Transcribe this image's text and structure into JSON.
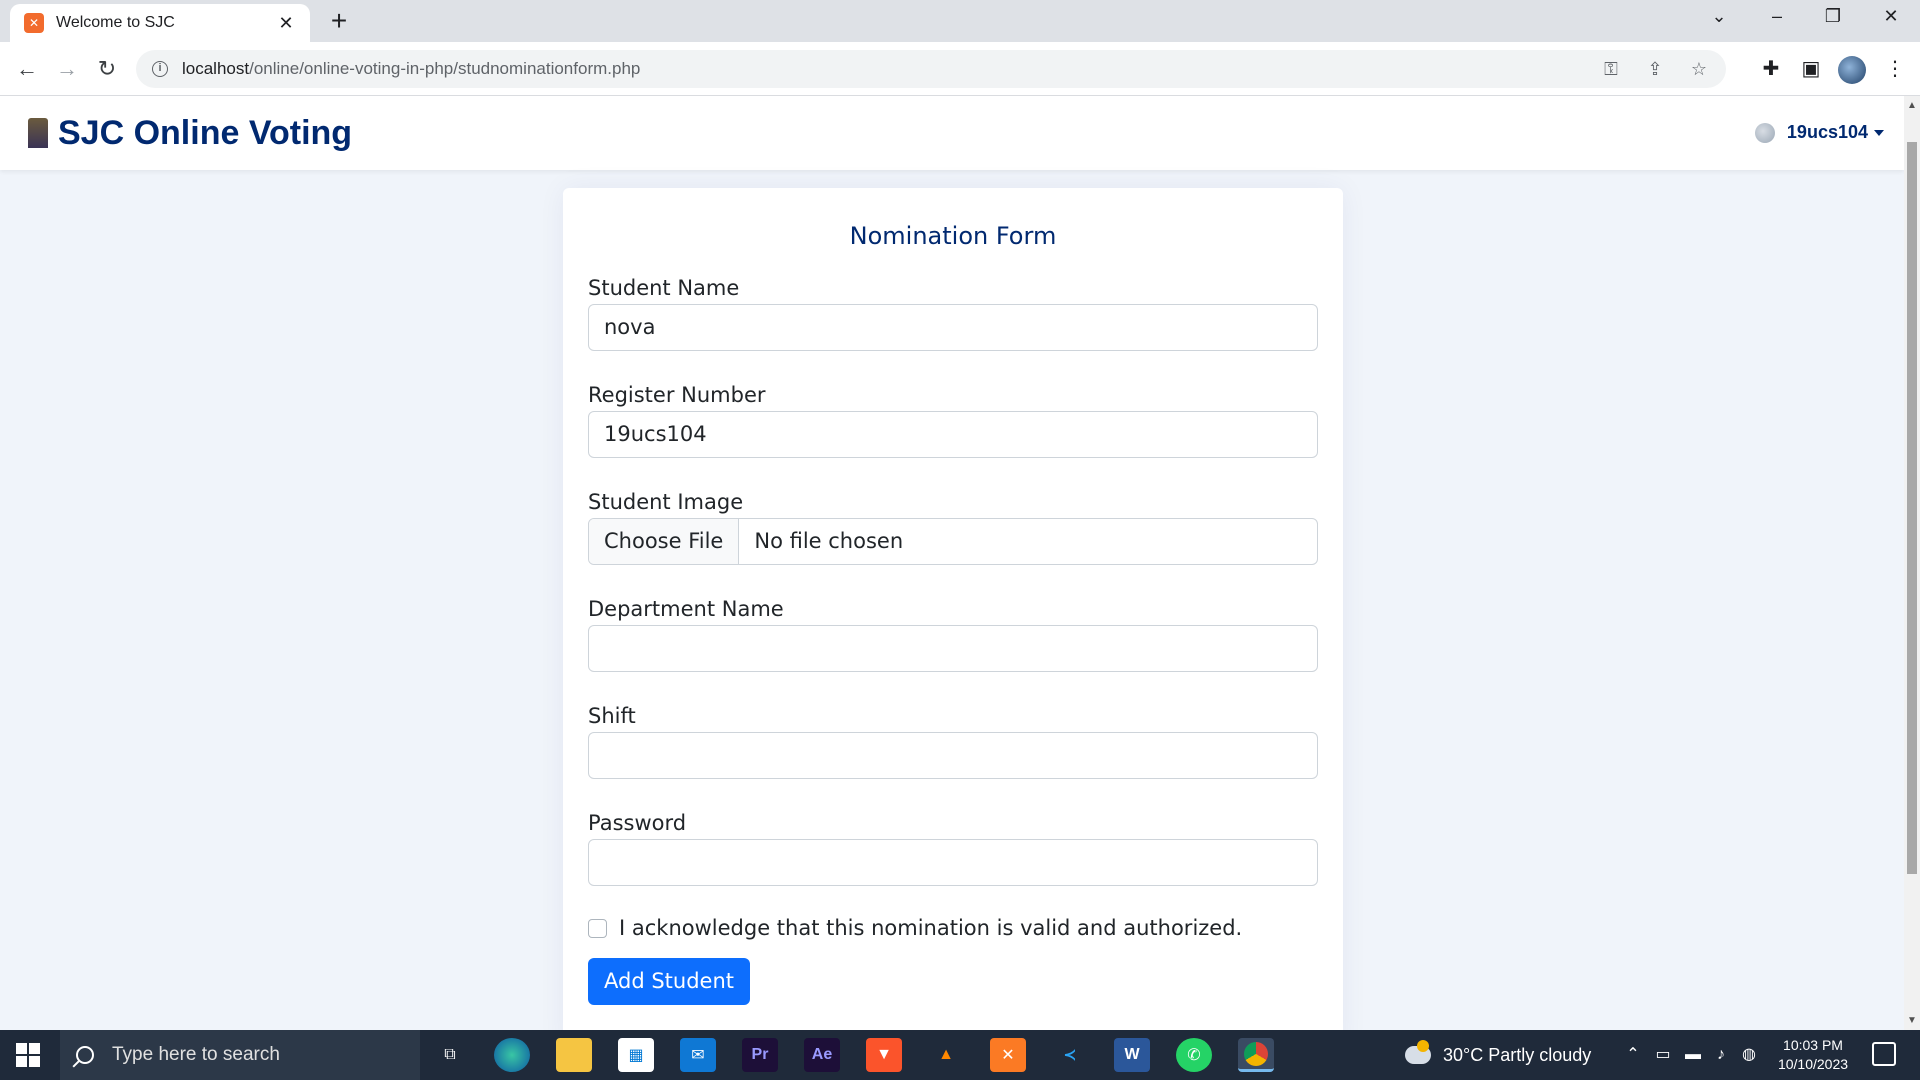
{
  "browser": {
    "tab_title": "Welcome to SJC",
    "tab_favicon": "xampp-icon",
    "url_host": "localhost",
    "url_path": "/online/online-voting-in-php/studnominationform.php"
  },
  "navbar": {
    "brand": "SJC Online Voting",
    "user": "19ucs104"
  },
  "form": {
    "title": "Nomination Form",
    "student_name_label": "Student Name",
    "student_name_value": "nova",
    "register_number_label": "Register Number",
    "register_number_value": "19ucs104",
    "student_image_label": "Student Image",
    "choose_file_label": "Choose File",
    "file_status": "No file chosen",
    "department_label": "Department Name",
    "department_value": "",
    "shift_label": "Shift",
    "shift_value": "",
    "password_label": "Password",
    "password_value": "",
    "acknowledge_label": "I acknowledge that this nomination is valid and authorized.",
    "acknowledge_checked": false,
    "submit_label": "Add Student"
  },
  "taskbar": {
    "search_placeholder": "Type here to search",
    "weather": "30°C  Partly cloudy",
    "time": "10:03 PM",
    "date": "10/10/2023",
    "apps": [
      "task-view-icon",
      "edge-icon",
      "file-explorer-icon",
      "microsoft-store-icon",
      "mail-icon",
      "premiere-pro-icon",
      "after-effects-icon",
      "brave-icon",
      "vlc-icon",
      "xampp-icon",
      "vscode-icon",
      "word-icon",
      "whatsapp-icon",
      "chrome-icon"
    ]
  },
  "colors": {
    "brand": "#012970",
    "primary_button": "#0d6efd",
    "page_background": "#f0f4fa"
  }
}
